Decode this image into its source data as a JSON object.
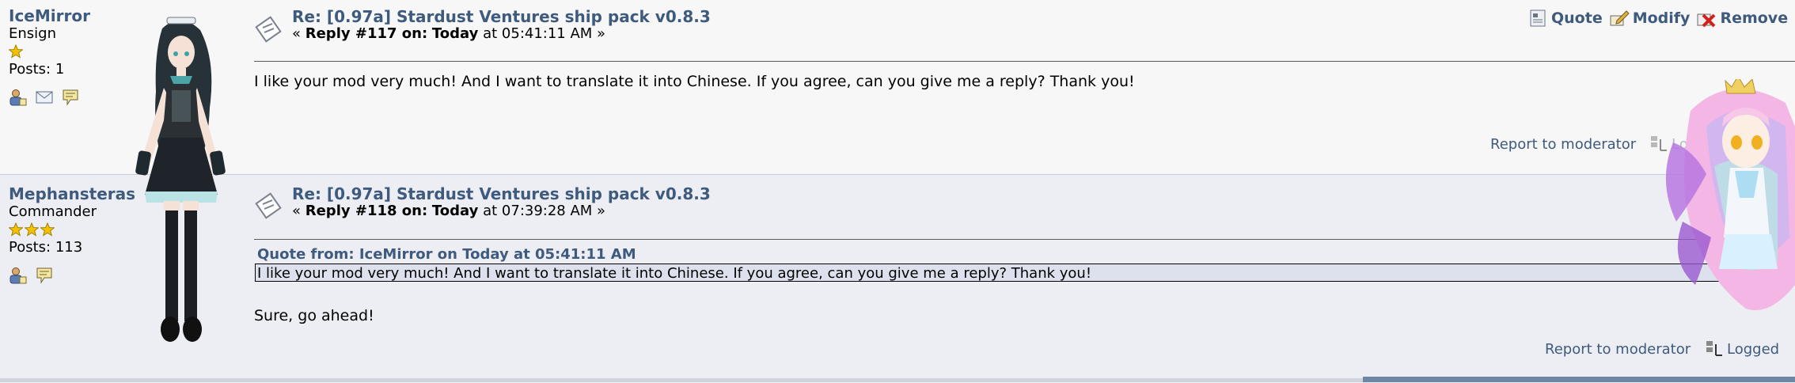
{
  "posts": [
    {
      "poster": {
        "name": "IceMirror",
        "rank": "Ensign",
        "star_count": 1,
        "posts_text": "Posts: 1",
        "icons": [
          "profile-icon",
          "email-icon",
          "pm-icon"
        ]
      },
      "subject": "Re: [0.97a] Stardust Ventures ship pack v0.8.3",
      "keyinfo": {
        "prefix": "« ",
        "reply": "Reply #117 on:",
        "day": "Today",
        "time": "at 05:41:11 AM »"
      },
      "actions": [
        {
          "label": "Quote",
          "icon": "quote-icon"
        },
        {
          "label": "Modify",
          "icon": "modify-icon"
        },
        {
          "label": "Remove",
          "icon": "remove-icon"
        }
      ],
      "body": "I like your mod very much! And I want to translate it into Chinese. If you agree, can you give me a reply? Thank you!",
      "report": "Report to moderator",
      "logged": "Logged"
    },
    {
      "poster": {
        "name": "Mephansteras",
        "rank": "Commander",
        "star_count": 3,
        "posts_text": "Posts: 113",
        "icons": [
          "profile-icon",
          "pm-icon"
        ]
      },
      "subject": "Re: [0.97a] Stardust Ventures ship pack v0.8.3",
      "keyinfo": {
        "prefix": "« ",
        "reply": "Reply #118 on:",
        "day": "Today",
        "time": "at 07:39:28 AM »"
      },
      "quote": {
        "header": "Quote from: IceMirror on Today at 05:41:11 AM",
        "text": "I like your mod very much! And I want to translate it into Chinese. If you agree, can you give me a reply? Thank you!"
      },
      "body": "Sure, go ahead!",
      "report": "Report to moderator",
      "logged": "Logged"
    }
  ],
  "colors": {
    "link": "#3e5a7d",
    "post_bg_1": "#f7f7f8",
    "post_bg_2": "#edeef3",
    "quote_bg": "#dde1ee",
    "star": "#f2c200"
  }
}
